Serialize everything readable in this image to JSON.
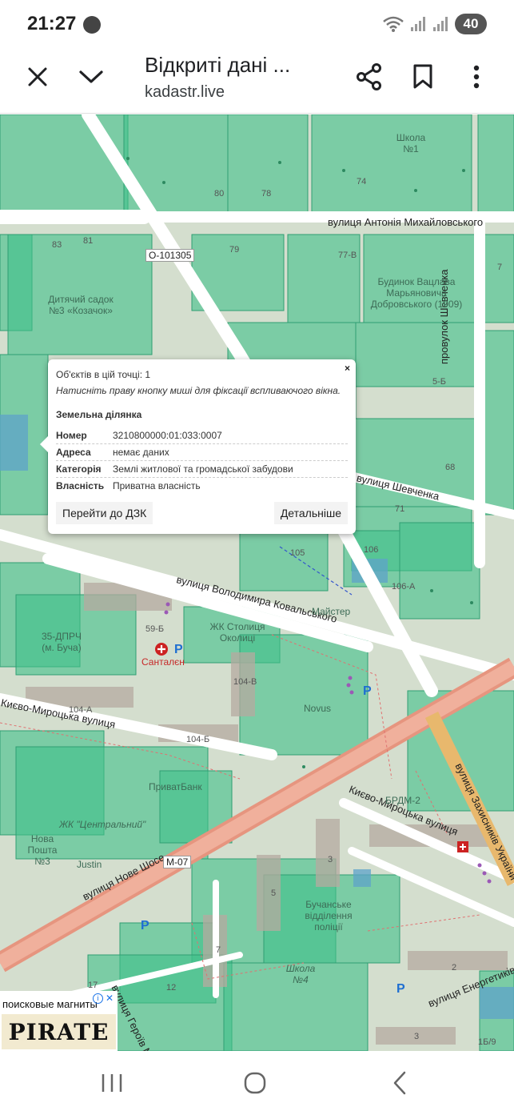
{
  "status_bar": {
    "time": "21:27",
    "battery": "40"
  },
  "browser": {
    "title": "Відкриті дані ...",
    "domain": "kadastr.live",
    "close_icon": "close-icon",
    "collapse_icon": "chevron-down-icon",
    "share_icon": "share-icon",
    "bookmark_icon": "bookmark-icon",
    "menu_icon": "more-vertical-icon"
  },
  "map": {
    "streets": {
      "mykhailovskoho": "вулиця Антонія Михайловського",
      "shevchenka_lane": "провулок Шевченка",
      "shevchenka": "вулиця Шевченка",
      "kovalskoho": "вулиця Володимира Ковальського",
      "kyivo_myrotska_left": "Києво-Мироцька вулиця",
      "kyivo_myrotska_right": "Києво-Мироцька вулиця",
      "zakhysnykiv": "вулиця Захисників України",
      "nove_shose": "вулиця Нове Шосе",
      "heroiv": "вулиця Героїв М",
      "enerhetykiv": "вулиця Енергетиків",
      "road_code": "O-101305",
      "road_m07": "M-07"
    },
    "numbers": {
      "n80": "80",
      "n78": "78",
      "n74": "74",
      "n83": "83",
      "n81": "81",
      "n79": "79",
      "n77v": "77-В",
      "n7": "7",
      "n5b": "5-Б",
      "n68": "68",
      "n71": "71",
      "n105": "105",
      "n106": "106",
      "n106a": "106-А",
      "n59b": "59-Б",
      "n104v": "104-В",
      "n104a": "104-А",
      "n104b": "104-Б",
      "n3": "3",
      "n5": "5",
      "n7b": "7",
      "n17": "17",
      "n12": "12",
      "n2": "2",
      "n3b": "3",
      "n1b9": "1Б/9"
    },
    "pois": {
      "school1": "Школа №1",
      "kindergarten": "Дитячий садок №3 «Козачок»",
      "dobrovsky_house": "Будинок Вацлава Марьяновича Добровського (1909)",
      "maister": "Майстер",
      "fire_station": "35-ДПРЧ (м. Буча)",
      "santalen": "Санталєн",
      "zhk_stolytsia": "ЖК Столиця Околиці",
      "novus": "Novus",
      "pryvatbank": "ПриватБанк",
      "zhk_central": "ЖК \"Центральний\"",
      "nova_poshta": "Нова Пошта №3",
      "justin": "Justin",
      "brdm": "БРДМ-2",
      "police": "Бучанське відділення поліції",
      "school4": "Школа №4"
    }
  },
  "popup": {
    "close_label": "×",
    "count_text": "Об'єктів в цій точці: 1",
    "hint_text": "Натисніть праву кнопку миші для фіксації вспливаючого вікна.",
    "section_title": "Земельна ділянка",
    "rows": [
      {
        "key": "Номер",
        "value": "3210800000:01:033:0007"
      },
      {
        "key": "Адреса",
        "value": "немає даних"
      },
      {
        "key": "Категорія",
        "value": "Землі житлової та громадської забудови"
      },
      {
        "key": "Власність",
        "value": "Приватна власність"
      }
    ],
    "go_button": "Перейти до ДЗК",
    "details_button": "Детальніше"
  },
  "ad": {
    "text": "поисковые магниты",
    "info": "i",
    "close": "✕",
    "logo": "PIRATE"
  },
  "colors": {
    "parcel_green": "#3fbf8a",
    "road": "#ffffff",
    "highway": "#e8927c",
    "popup_bg": "#ffffff"
  }
}
